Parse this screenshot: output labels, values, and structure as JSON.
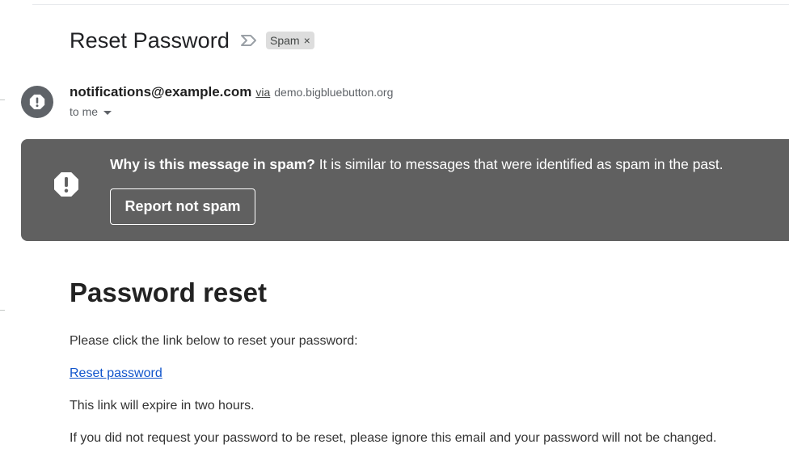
{
  "email": {
    "subject": "Reset Password",
    "label_chip": "Spam",
    "chip_close": "×",
    "sender": {
      "email": "notifications@example.com",
      "via_label": "via",
      "via_domain": "demo.bigbluebutton.org",
      "recipient": "to me"
    }
  },
  "spam_banner": {
    "bold_text": "Why is this message in spam?",
    "text": " It is similar to messages that were identified as spam in the past.",
    "button_label": "Report not spam"
  },
  "body": {
    "heading": "Password reset",
    "line1": "Please click the link below to reset your password:",
    "link": "Reset password",
    "line2": "This link will expire in two hours.",
    "line3": "If you did not request your password to be reset, please ignore this email and your password will not be changed."
  },
  "colors": {
    "banner_bg": "#606060",
    "avatar_bg": "#5f6368",
    "link": "#1155cc",
    "chip_bg": "#dddddd"
  },
  "icons": {
    "importance": "importance-marker-icon",
    "avatar": "alert-icon",
    "banner": "alert-octagon-icon",
    "recipient_dropdown": "chevron-down-icon"
  }
}
